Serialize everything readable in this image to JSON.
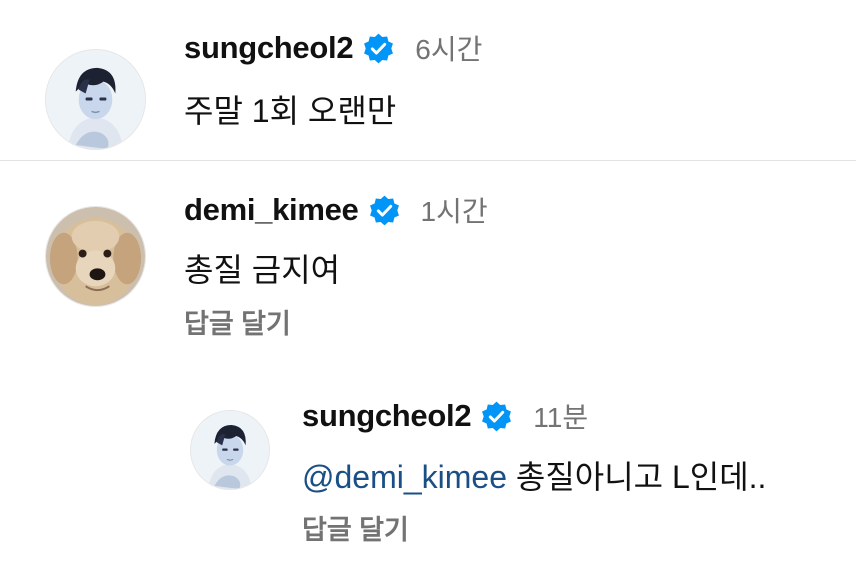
{
  "comments": [
    {
      "username": "sungcheol2",
      "time": "6시간",
      "text": "주말 1회 오랜만",
      "avatar_icon": "cartoon-boy-avatar"
    },
    {
      "username": "demi_kimee",
      "time": "1시간",
      "text": "총질 금지여",
      "reply_label": "답글 달기",
      "avatar_icon": "dog-avatar"
    }
  ],
  "reply": {
    "username": "sungcheol2",
    "time": "11분",
    "mention": "@demi_kimee",
    "text": " 총질아니고 L인데..",
    "reply_label": "답글 달기",
    "avatar_icon": "cartoon-boy-avatar"
  },
  "colors": {
    "verified": "#0095f6",
    "mention": "#1a4f86",
    "muted": "#737373"
  }
}
